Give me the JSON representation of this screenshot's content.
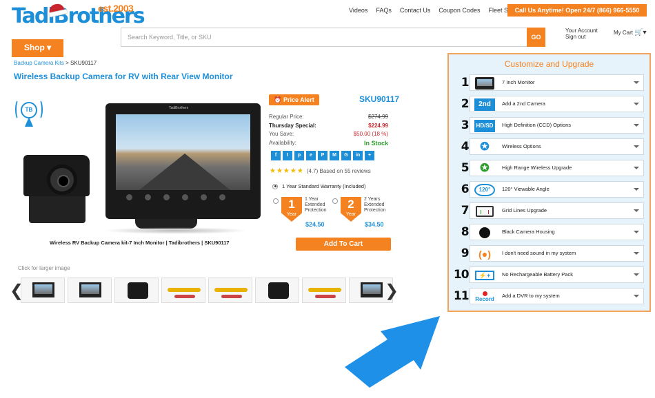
{
  "logo": {
    "brand": "TadiBrothers",
    "est": "est.2003"
  },
  "topnav": [
    "Videos",
    "FAQs",
    "Contact Us",
    "Coupon Codes",
    "Fleet Sales"
  ],
  "call_button": "Call Us Anytime! Open 24/7 (866) 966-5550",
  "search": {
    "placeholder": "Search Keyword, Title, or SKU",
    "go_label": "GO"
  },
  "account": {
    "line1": "Your Account",
    "line2": "Sign out"
  },
  "cart": {
    "label": "My Cart"
  },
  "shop_button": "Shop ▾",
  "breadcrumb": {
    "link": "Backup Camera Kits",
    "separator": " > ",
    "current": "SKU90117"
  },
  "product": {
    "title": "Wireless Backup Camera for RV with Rear View Monitor",
    "badge": "TB",
    "monitor_brand": "TadiBrothers",
    "caption": "Wireless RV Backup Camera kit-7 Inch Monitor | Tadibrothers | SKU90117",
    "larger_hint": "Click for larger image",
    "price_alert": "Price Alert",
    "sku": "SKU90117",
    "prices": {
      "regular_label": "Regular Price:",
      "regular_value": "$274.99",
      "special_label": "Thursday Special:",
      "special_value": "$224.99",
      "save_label": "You Save:",
      "save_value": "$50.00 (18 %)",
      "availability_label": "Availability:",
      "availability_value": "In Stock"
    },
    "social_icons": [
      "f",
      "t",
      "p",
      "e",
      "P",
      "M",
      "G",
      "in",
      "+"
    ],
    "rating": {
      "stars": "★★★★★",
      "text": "(4.7) Based on 55 reviews"
    },
    "warranty_standard": "1 Year Standard Warranty (Included)",
    "extended": [
      {
        "num": "1",
        "unit": "Year",
        "l1": "1 Year",
        "l2": "Extended",
        "l3": "Protection",
        "price": "$24.50"
      },
      {
        "num": "2",
        "unit": "Year",
        "l1": "2 Years",
        "l2": "Extended",
        "l3": "Protection",
        "price": "$34.50"
      }
    ],
    "add_to_cart": "Add To Cart"
  },
  "customize": {
    "title": "Customize and Upgrade",
    "options": [
      {
        "num": "1.",
        "icon": "monitor-icon",
        "label": "7 Inch Monitor"
      },
      {
        "num": "2.",
        "icon": "second-camera-icon",
        "icon_text": "2nd",
        "label": "Add a 2nd Camera"
      },
      {
        "num": "3.",
        "icon": "hd-sd-icon",
        "icon_text": "HD/SD",
        "label": "High Definition (CCD) Options"
      },
      {
        "num": "4.",
        "icon": "wifi-icon",
        "label": "Wireless Options"
      },
      {
        "num": "5.",
        "icon": "wifi-green-icon",
        "label": "High Range Wireless Upgrade"
      },
      {
        "num": "6.",
        "icon": "angle-120-icon",
        "icon_text": "120°",
        "label": "120° Viewable Angle"
      },
      {
        "num": "7.",
        "icon": "grid-lines-icon",
        "label": "Grid Lines Upgrade"
      },
      {
        "num": "8.",
        "icon": "black-housing-icon",
        "label": "Black Camera Housing"
      },
      {
        "num": "9.",
        "icon": "sound-icon",
        "label": "I don't need sound in my system"
      },
      {
        "num": "10.",
        "icon": "battery-icon",
        "icon_text": "⚡+",
        "label": "No Rechargeable Battery Pack"
      },
      {
        "num": "11.",
        "icon": "record-icon",
        "icon_text": "Record",
        "label": "Add a DVR to my system"
      }
    ]
  },
  "colors": {
    "accent": "#f58220",
    "brand_blue": "#1d8fd8",
    "panel_bg": "#e6f3fb",
    "sale_red": "#c9252c",
    "stock_green": "#2a9d2a"
  }
}
